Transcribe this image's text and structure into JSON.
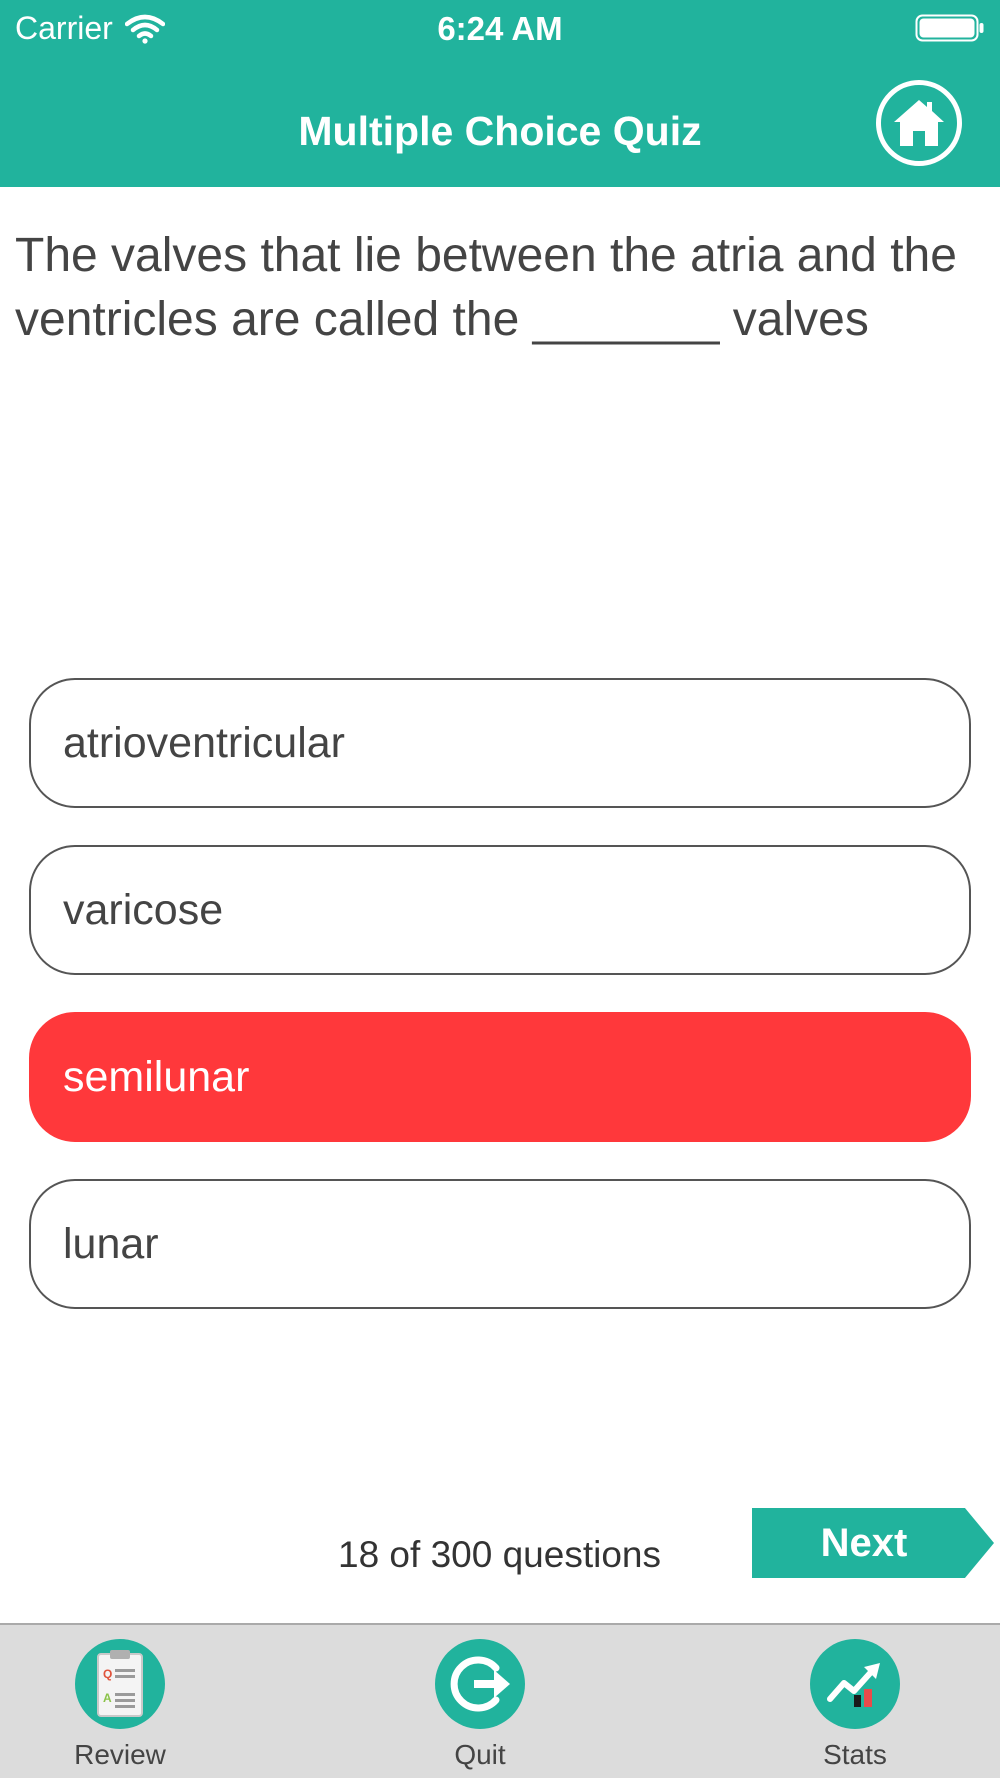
{
  "status_bar": {
    "carrier": "Carrier",
    "time": "6:24 AM"
  },
  "header": {
    "title": "Multiple Choice Quiz",
    "home_icon": "home-icon"
  },
  "question": {
    "text": "The valves that lie between the atria and the ventricles are called the _______ valves"
  },
  "answers": [
    {
      "label": "atrioventricular",
      "state": "default"
    },
    {
      "label": "varicose",
      "state": "default"
    },
    {
      "label": "semilunar",
      "state": "incorrect"
    },
    {
      "label": "lunar",
      "state": "default"
    }
  ],
  "footer": {
    "progress": "18 of 300 questions",
    "next_label": "Next"
  },
  "tabs": [
    {
      "label": "Review",
      "icon": "review-icon"
    },
    {
      "label": "Quit",
      "icon": "quit-icon"
    },
    {
      "label": "Stats",
      "icon": "stats-icon"
    }
  ],
  "colors": {
    "accent": "#21b39d",
    "incorrect": "#ff383b",
    "tab_bar": "#dcdcdc"
  }
}
